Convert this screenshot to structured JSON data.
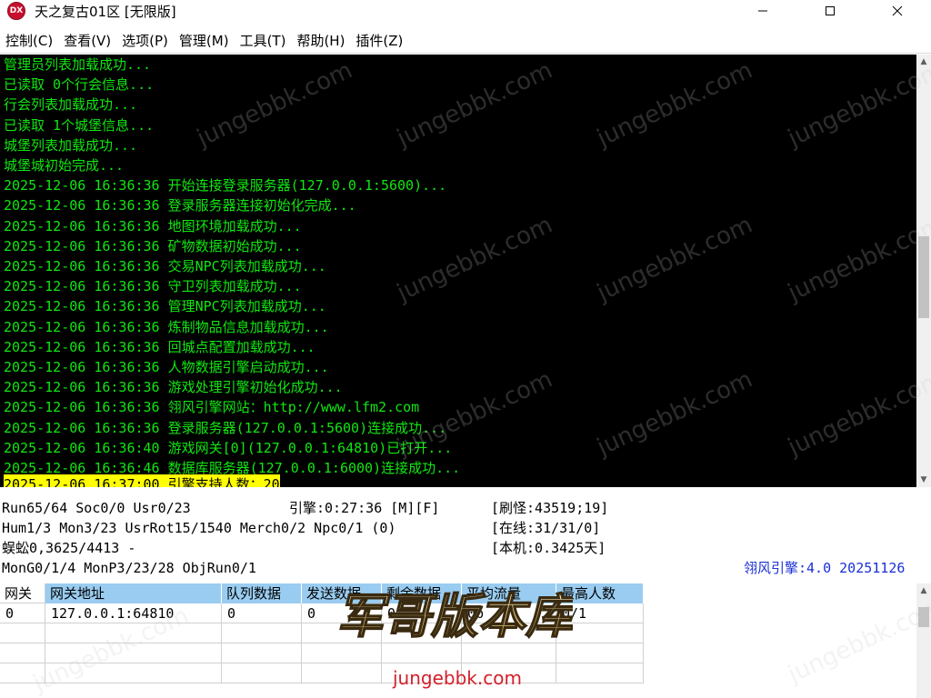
{
  "window": {
    "app_icon_label": "DX",
    "title": "天之复古01区 [无限版]",
    "minimize_glyph": "—",
    "maximize_glyph": "☐",
    "close_glyph": "✕"
  },
  "menu": [
    "控制(C)",
    "查看(V)",
    "选项(P)",
    "管理(M)",
    "工具(T)",
    "帮助(H)",
    "插件(Z)"
  ],
  "console": {
    "lines": [
      "管理员列表加载成功...",
      "已读取 0个行会信息...",
      "行会列表加载成功...",
      "已读取 1个城堡信息...",
      "城堡列表加载成功...",
      "城堡城初始完成...",
      "2025-12-06 16:36:36 开始连接登录服务器(127.0.0.1:5600)...",
      "2025-12-06 16:36:36 登录服务器连接初始化完成...",
      "2025-12-06 16:36:36 地图环境加载成功...",
      "2025-12-06 16:36:36 矿物数据初始成功...",
      "2025-12-06 16:36:36 交易NPC列表加载成功...",
      "2025-12-06 16:36:36 守卫列表加载成功...",
      "2025-12-06 16:36:36 管理NPC列表加载成功...",
      "2025-12-06 16:36:36 炼制物品信息加载成功...",
      "2025-12-06 16:36:36 回城点配置加载成功...",
      "2025-12-06 16:36:36 人物数据引擎启动成功...",
      "2025-12-06 16:36:36 游戏处理引擎初始化成功...",
      "2025-12-06 16:36:36 翎风引擎网站：http://www.lfm2.com",
      "2025-12-06 16:36:36 登录服务器(127.0.0.1:5600)连接成功...",
      "2025-12-06 16:36:40 游戏网关[0](127.0.0.1:64810)已打开...",
      "2025-12-06 16:36:46 数据库服务器(127.0.0.1:6000)连接成功...",
      "2025-12-06 16:37:00 引擎支持人数：20"
    ]
  },
  "status": {
    "line1_left": "Run65/64 Soc0/0 Usr0/23",
    "engine_time": "引擎:0:27:36 [M][F]",
    "monster_refresh": "[刷怪:43519;19]",
    "line2_left": "Hum1/3 Mon3/23 UsrRot15/1540 Merch0/2 Npc0/1 (0)",
    "online": "[在线:31/31/0]",
    "line3_left": "蜈蚣0,3625/4413 -",
    "local": "[本机:0.3425天]",
    "line4_left": "MonG0/1/4 MonP3/23/28 ObjRun0/1",
    "engine_version": "翎风引擎:4.0 20251126"
  },
  "grid": {
    "columns": [
      "网关",
      "网关地址",
      "队列数据",
      "发送数据",
      "剩余数据",
      "平均流量",
      "最高人数"
    ],
    "rows": [
      [
        "0",
        "127.0.0.1:64810",
        "0",
        "0",
        "0",
        "0b",
        "0/1"
      ]
    ]
  },
  "watermark": {
    "text": "jungebbk.com",
    "logo_text": "军哥版本库",
    "logo_url": "jungebbk.com"
  }
}
